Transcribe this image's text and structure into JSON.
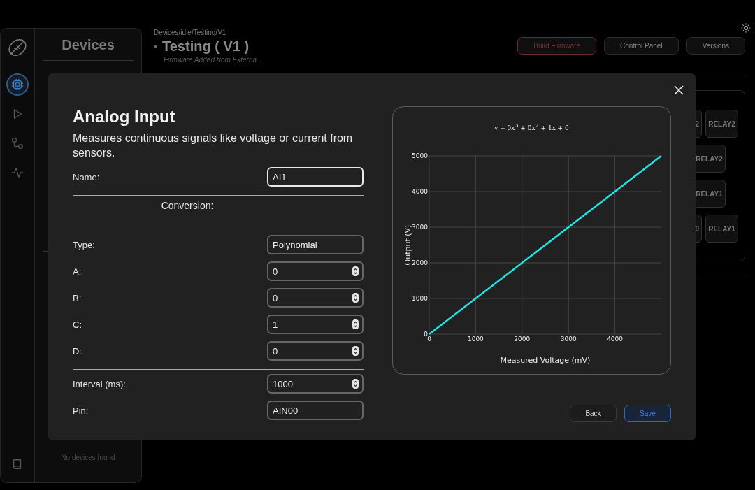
{
  "sidebar": {
    "items": [
      {
        "selected": true
      },
      {
        "selected": false
      },
      {
        "selected": false
      },
      {
        "selected": false
      },
      {
        "selected": false
      }
    ]
  },
  "devices_panel": {
    "title": "Devices",
    "empty_message": "No devices found"
  },
  "header": {
    "breadcrumb": "Devices/idle/Testing/V1",
    "title": "Testing ( V1 )",
    "subtitle": "Firmware Added from Externa...",
    "buttons": [
      {
        "label": "Build Firmware",
        "kind": "danger"
      },
      {
        "label": "Control Panel",
        "kind": "default"
      },
      {
        "label": "Versions",
        "kind": "default"
      }
    ]
  },
  "relay_panel": {
    "rows": [
      [
        {
          "label": "2"
        },
        {
          "label": "RELAY2"
        }
      ],
      [
        {
          "label": "RELAY2"
        }
      ],
      [
        {
          "label": "RELAY1"
        }
      ],
      [
        {
          "label": "0"
        },
        {
          "label": "RELAY1"
        }
      ]
    ]
  },
  "modal": {
    "title": "Analog Input",
    "description": "Measures continuous signals like voltage or current from sensors.",
    "sections": [
      {
        "fields": [
          {
            "label": "Name:",
            "value": "AI1",
            "kind": "text",
            "focused": true
          }
        ]
      },
      {
        "heading": "Conversion:",
        "fields": [
          {
            "label": "Type:",
            "value": "Polynomial",
            "kind": "text",
            "focused": false
          },
          {
            "label": "A:",
            "value": "0",
            "kind": "number",
            "focused": false
          },
          {
            "label": "B:",
            "value": "0",
            "kind": "number",
            "focused": false
          },
          {
            "label": "C:",
            "value": "1",
            "kind": "number",
            "focused": false
          },
          {
            "label": "D:",
            "value": "0",
            "kind": "number",
            "focused": false
          }
        ]
      },
      {
        "fields": [
          {
            "label": "Interval (ms):",
            "value": "1000",
            "kind": "number",
            "focused": false
          },
          {
            "label": "Pin:",
            "value": "AIN00",
            "kind": "text",
            "focused": false
          }
        ]
      }
    ],
    "chart_data": {
      "type": "line",
      "grid": true,
      "title": "y = 0x$^{3}$ + 0x$^{2}$ + 1x + 0",
      "xlabel": "Measured Voltage (mV)",
      "ylabel": "Output (V)",
      "x": [
        0,
        5000
      ],
      "series": [
        {
          "color": "#22e5e5",
          "values": [
            0,
            5000
          ]
        }
      ],
      "xlim": [
        0,
        5000
      ],
      "ylim": [
        0,
        5000
      ],
      "xticks": [
        {
          "value": 0,
          "label": "0"
        },
        {
          "value": 1000,
          "label": "1000"
        },
        {
          "value": 2000,
          "label": "2000"
        },
        {
          "value": 3000,
          "label": "3000"
        },
        {
          "value": 4000,
          "label": "4000"
        }
      ],
      "yticks": [
        {
          "value": 0,
          "label": "0"
        },
        {
          "value": 1000,
          "label": "1000"
        },
        {
          "value": 2000,
          "label": "2000"
        },
        {
          "value": 3000,
          "label": "3000"
        },
        {
          "value": 4000,
          "label": "4000"
        },
        {
          "value": 5000,
          "label": "5000"
        }
      ]
    },
    "buttons": [
      {
        "label": "Back",
        "kind": "default"
      },
      {
        "label": "Save",
        "kind": "primary"
      }
    ]
  }
}
